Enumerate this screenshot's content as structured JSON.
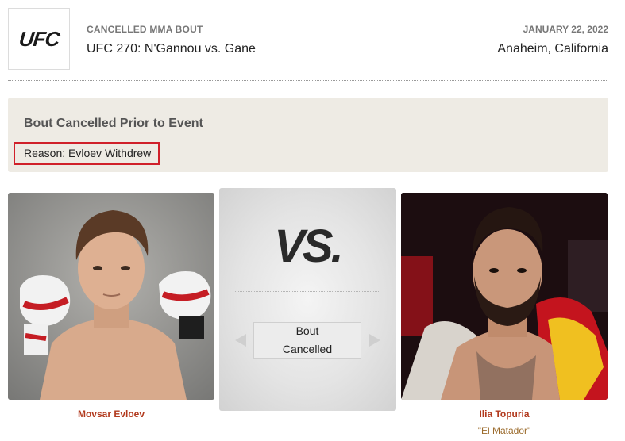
{
  "header": {
    "logo_text": "UFC",
    "event_type": "CANCELLED MMA BOUT",
    "event_name": "UFC 270: N'Gannou vs. Gane",
    "date": "JANUARY 22, 2022",
    "location": "Anaheim, California"
  },
  "cancellation": {
    "title": "Bout Cancelled Prior to Event",
    "reason": "Reason: Evloev Withdrew",
    "highlight_color": "#d0202a"
  },
  "matchup": {
    "vs_label": "VS.",
    "status_line1": "Bout",
    "status_line2": "Cancelled"
  },
  "fighters": {
    "left": {
      "name": "Movsar Evloev",
      "photo": "fighter-photo-red-gloves"
    },
    "right": {
      "name": "Ilia Topuria",
      "nickname": "\"El Matador\"",
      "photo": "fighter-photo-flag"
    }
  },
  "colors": {
    "accent": "#b23a1e",
    "nickname": "#9b6b2c",
    "panel": "#eeebe4"
  }
}
